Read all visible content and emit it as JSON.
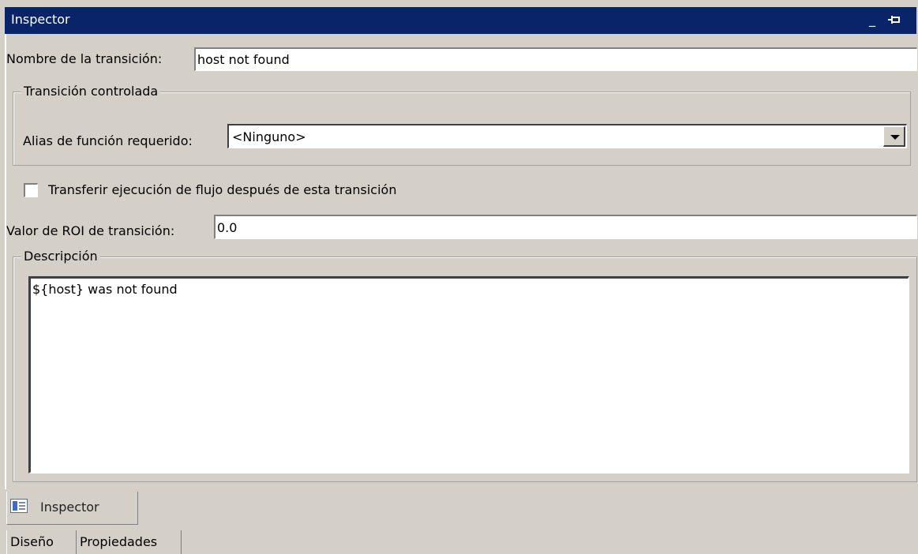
{
  "window": {
    "title": "Inspector",
    "minimize_glyph": "_",
    "pin_glyph": "⊣"
  },
  "form": {
    "name_label": "Nombre de la transición:",
    "name_value": "host not found",
    "controlled_group_label": "Transición controlada",
    "alias_label": "Alias de función requerido:",
    "alias_value": "<Ninguno>",
    "transfer_label": "Transferir ejecución de flujo después de esta transición",
    "transfer_checked": false,
    "roi_label": "Valor de ROI de transición:",
    "roi_value": "0.0",
    "description_group_label": "Descripción",
    "description_value": "${host} was not found"
  },
  "bottom": {
    "tab_label": "Inspector",
    "subtabs": [
      "Diseño",
      "Propiedades"
    ]
  }
}
